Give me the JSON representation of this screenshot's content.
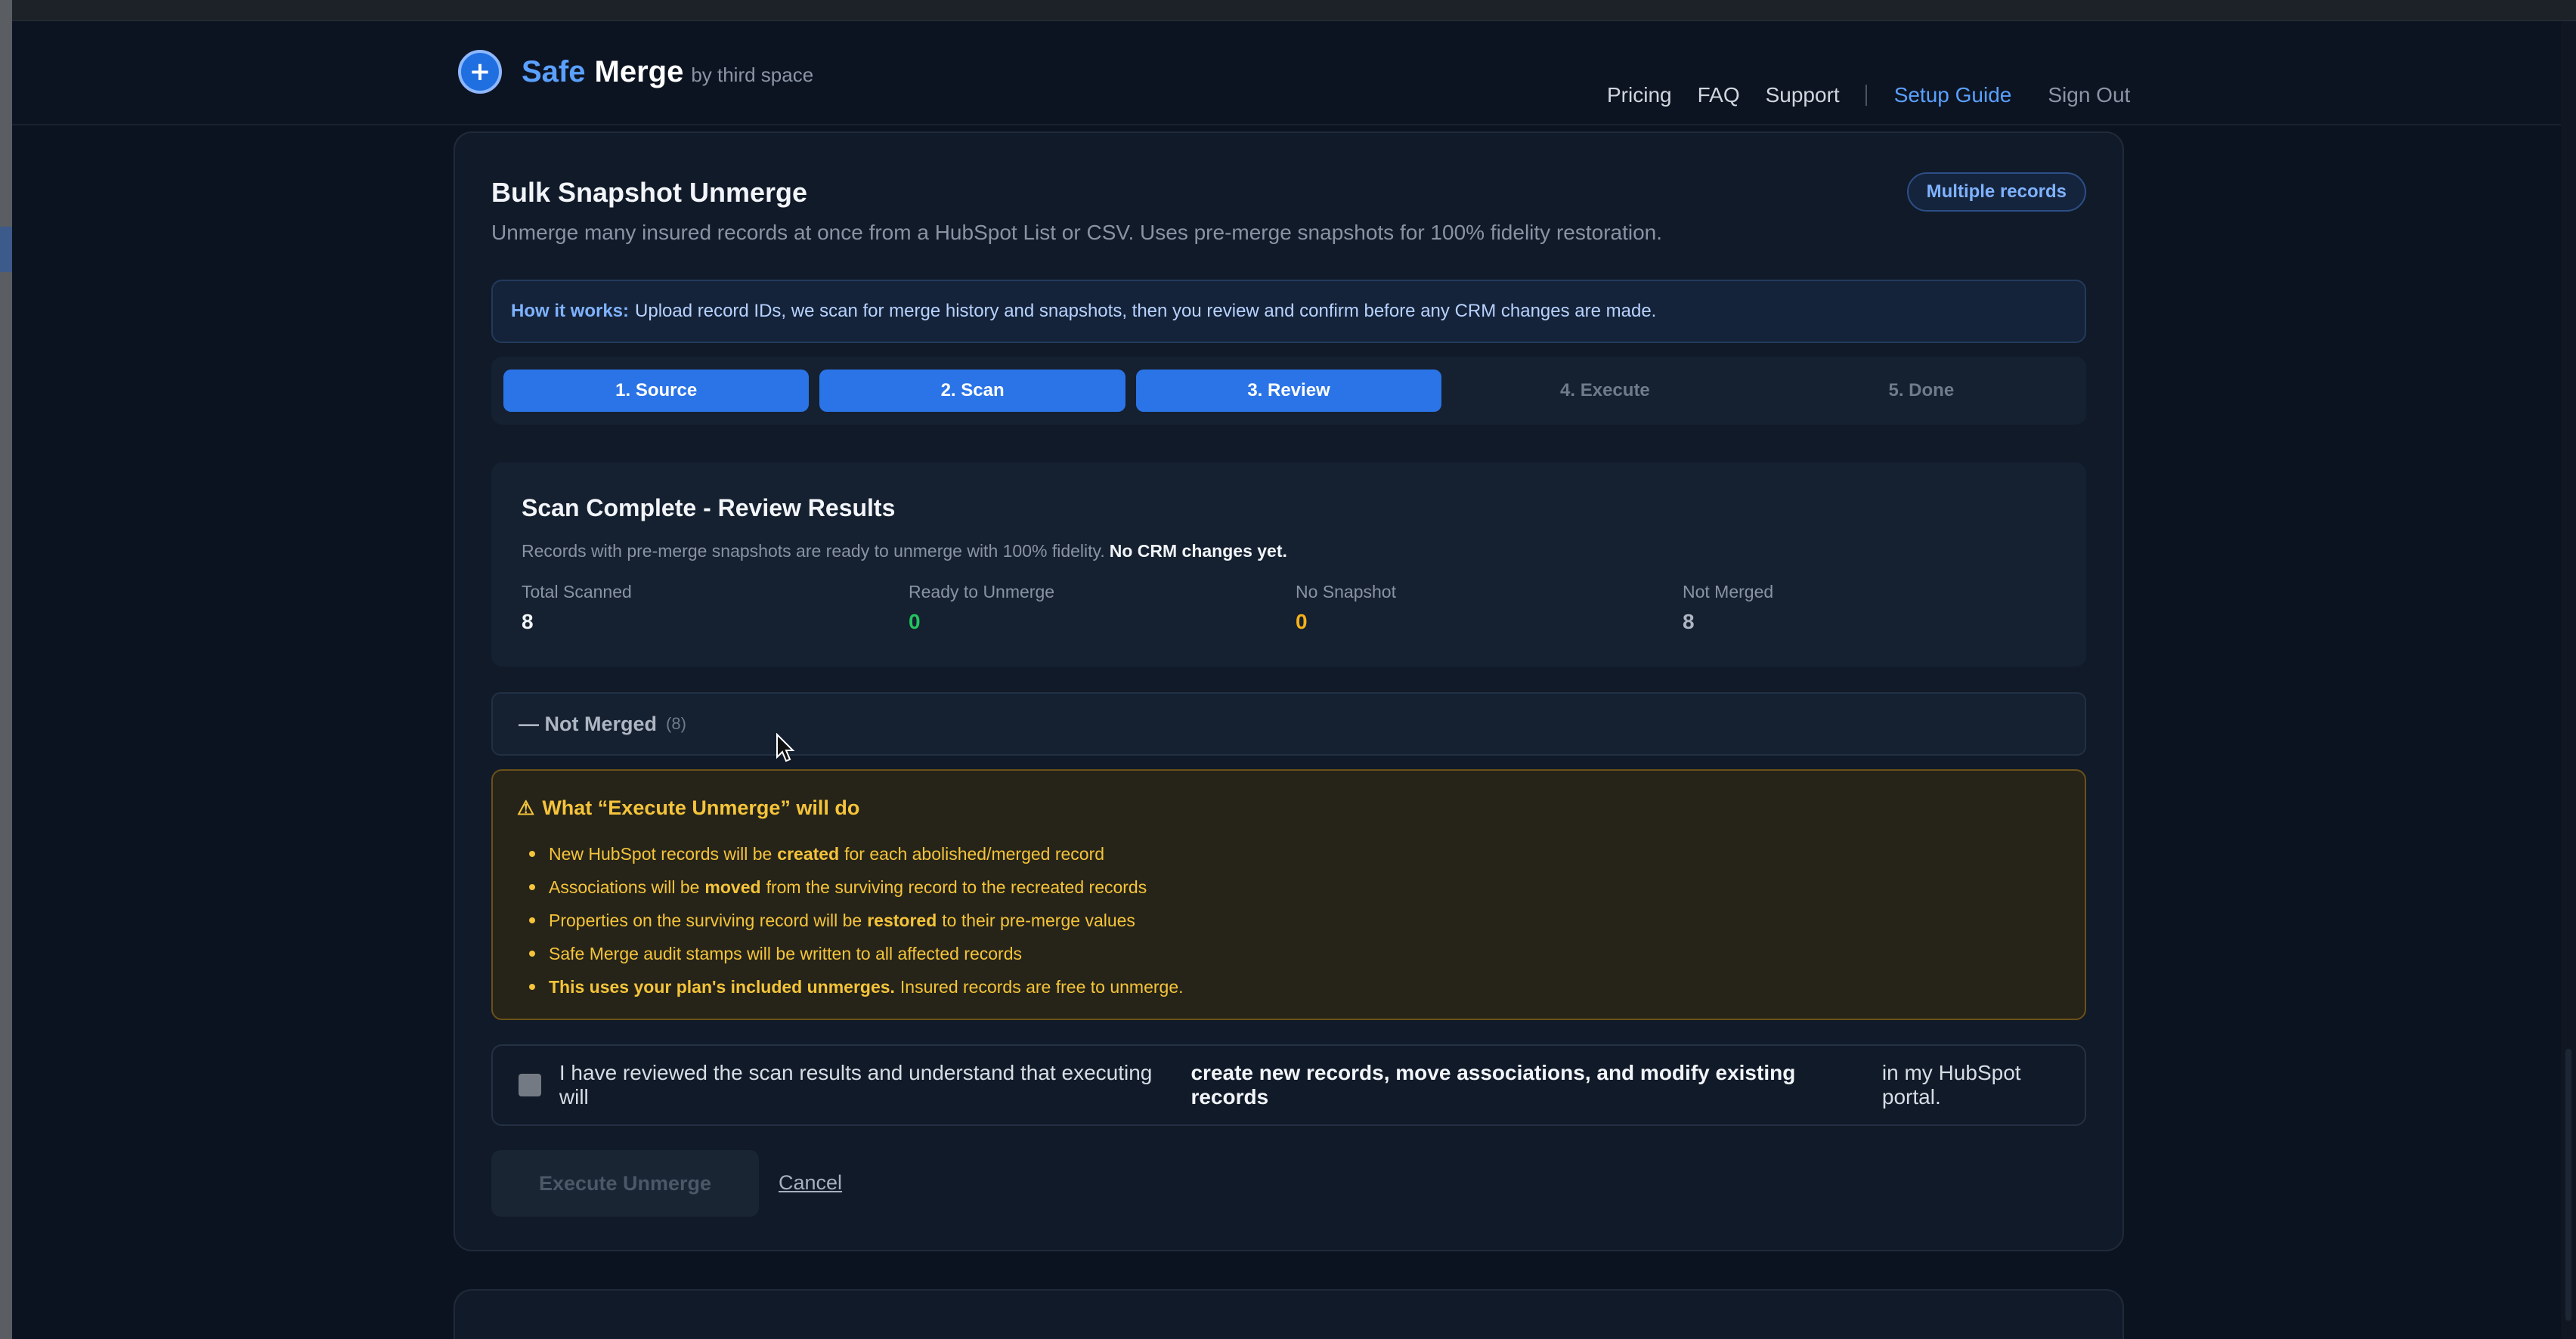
{
  "header": {
    "brand_safe": "Safe",
    "brand_merge": "Merge",
    "brand_by": "by third space",
    "nav": [
      "Pricing",
      "FAQ",
      "Support"
    ],
    "setup_guide": "Setup Guide",
    "sign_out": "Sign Out"
  },
  "card": {
    "title": "Bulk Snapshot Unmerge",
    "badge": "Multiple records",
    "subtitle": "Unmerge many insured records at once from a HubSpot List or CSV. Uses pre-merge snapshots for 100% fidelity restoration.",
    "how_label": "How it works:",
    "how_text": "Upload record IDs, we scan for merge history and snapshots, then you review and confirm before any CRM changes are made."
  },
  "steps": [
    {
      "label": "1. Source",
      "state": "done"
    },
    {
      "label": "2. Scan",
      "state": "done"
    },
    {
      "label": "3. Review",
      "state": "done"
    },
    {
      "label": "4. Execute",
      "state": "pending"
    },
    {
      "label": "5. Done",
      "state": "pending"
    }
  ],
  "scan": {
    "title": "Scan Complete - Review Results",
    "desc": "Records with pre-merge snapshots are ready to unmerge with 100% fidelity.",
    "desc_bold": "No CRM changes yet.",
    "stats": [
      {
        "label": "Total Scanned",
        "value": "8",
        "color": "#f2f5f9"
      },
      {
        "label": "Ready to Unmerge",
        "value": "0",
        "color": "#22c55e"
      },
      {
        "label": "No Snapshot",
        "value": "0",
        "color": "#f5b01a"
      },
      {
        "label": "Not Merged",
        "value": "8",
        "color": "#aeb6c2"
      }
    ]
  },
  "not_merged": {
    "label": "— Not Merged",
    "count": "(8)"
  },
  "warning": {
    "title": "What “Execute Unmerge” will do",
    "items": [
      {
        "pre": "New HubSpot records will be",
        "bold": "created",
        "post": "for each abolished/merged record"
      },
      {
        "pre": "Associations will be",
        "bold": "moved",
        "post": "from the surviving record to the recreated records"
      },
      {
        "pre": "Properties on the surviving record will be",
        "bold": "restored",
        "post": "to their pre-merge values"
      },
      {
        "pre": "Safe Merge audit stamps will be written to all affected records",
        "bold": "",
        "post": ""
      },
      {
        "pre": "",
        "bold": "This uses your plan's included unmerges.",
        "post": "Insured records are free to unmerge."
      }
    ]
  },
  "confirm": {
    "pre": "I have reviewed the scan results and understand that executing will",
    "bold": "create new records, move associations, and modify existing records",
    "post": "in my HubSpot portal."
  },
  "actions": {
    "execute": "Execute Unmerge",
    "cancel": "Cancel"
  },
  "colors": {
    "accent": "#2b74e8",
    "warning": "#f5c43a"
  },
  "icons": {
    "logo": "plus-circle-icon",
    "warning": "warning-triangle-icon",
    "cursor": "mouse-pointer-icon"
  }
}
